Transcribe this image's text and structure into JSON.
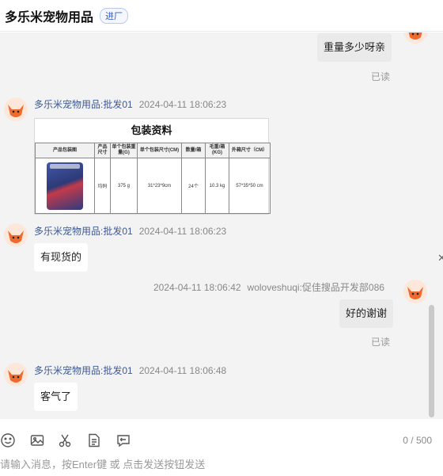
{
  "header": {
    "shop_name": "多乐米宠物用品",
    "badge": "进厂"
  },
  "messages": [
    {
      "type": "self_text",
      "text": "重量多少呀亲",
      "status": "已读"
    },
    {
      "type": "image",
      "sender": "多乐米宠物用品:批发01",
      "time": "2024-04-11 18:06:23"
    },
    {
      "type": "text",
      "sender": "多乐米宠物用品:批发01",
      "time": "2024-04-11 18:06:23",
      "text": "有现货的"
    },
    {
      "type": "self_text",
      "sender": "woloveshuqi:促佳搜品开发部086",
      "time": "2024-04-11 18:06:42",
      "text": "好的谢谢",
      "status": "已读"
    },
    {
      "type": "text",
      "sender": "多乐米宠物用品:批发01",
      "time": "2024-04-11 18:06:48",
      "text": "客气了"
    }
  ],
  "package_image": {
    "title": "包装资料",
    "headers": [
      "产品包装图",
      "产品尺寸",
      "单个包装重量(G)",
      "单个包装尺寸(CM)",
      "数量/箱",
      "毛重/箱(KG)",
      "外箱尺寸（CM）"
    ],
    "row": [
      "",
      "均码",
      "375 g",
      "31*23*9cm",
      "24个",
      "10.3 kg",
      "57*35*50 cm"
    ]
  },
  "toolbar": {
    "icons": [
      "emoji-icon",
      "image-icon",
      "scissors-icon",
      "document-icon",
      "quick-reply-icon"
    ],
    "counter": "0 / 500"
  },
  "input": {
    "placeholder": "请输入消息，按Enter键 或 点击发送按钮发送"
  }
}
